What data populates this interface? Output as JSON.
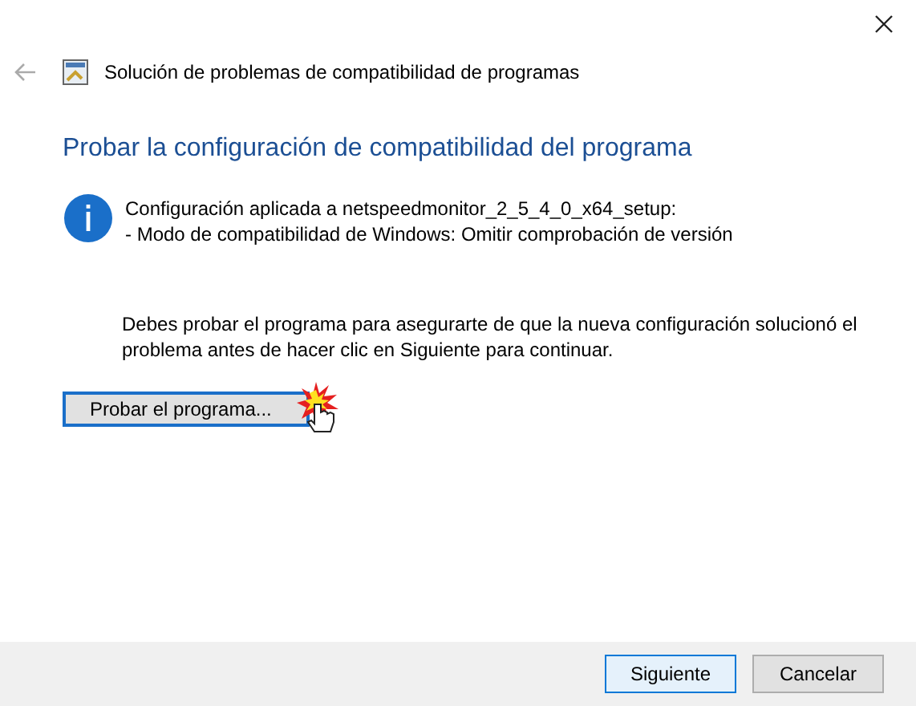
{
  "window": {
    "title": "Solución de problemas de compatibilidad de programas"
  },
  "heading": "Probar la configuración de compatibilidad del programa",
  "info": {
    "lines": [
      "Configuración aplicada a netspeedmonitor_2_5_4_0_x64_setup:",
      "- Modo de compatibilidad de Windows: Omitir comprobación de versión"
    ]
  },
  "instruction": "Debes probar el programa para asegurarte de que la nueva configuración solucionó el problema antes de hacer clic en Siguiente para continuar.",
  "test_button": {
    "label": "Probar el programa..."
  },
  "buttons": [
    {
      "label": "Siguiente",
      "selected": true
    },
    {
      "label": "Cancelar",
      "selected": false
    }
  ]
}
